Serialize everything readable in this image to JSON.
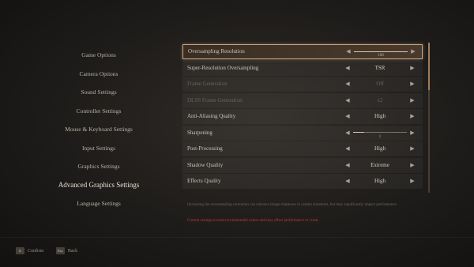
{
  "menu": {
    "items": [
      {
        "label": "Game Options",
        "active": false
      },
      {
        "label": "Camera Options",
        "active": false
      },
      {
        "label": "Sound Settings",
        "active": false
      },
      {
        "label": "Controller Settings",
        "active": false
      },
      {
        "label": "Mouse & Keyboard Settings",
        "active": false
      },
      {
        "label": "Input Settings",
        "active": false
      },
      {
        "label": "Graphics Settings",
        "active": false
      },
      {
        "label": "Advanced Graphics Settings",
        "active": true
      },
      {
        "label": "Language Settings",
        "active": false
      }
    ]
  },
  "settings": {
    "rows": [
      {
        "label": "Oversampling Resolution",
        "type": "slider",
        "value": "100",
        "fill": 1.0,
        "selected": true,
        "disabled": false
      },
      {
        "label": "Super-Resolution Oversampling",
        "type": "option",
        "value": "TSR",
        "selected": false,
        "disabled": false
      },
      {
        "label": "Frame Generation",
        "type": "option",
        "value": "Off",
        "selected": false,
        "disabled": true
      },
      {
        "label": "DLSS Frame Generation",
        "type": "option",
        "value": "x2",
        "selected": false,
        "disabled": true
      },
      {
        "label": "Anti-Aliasing Quality",
        "type": "option",
        "value": "High",
        "selected": false,
        "disabled": false
      },
      {
        "label": "Sharpening",
        "type": "slider",
        "value": "1",
        "fill": 0.2,
        "selected": false,
        "disabled": false
      },
      {
        "label": "Post-Processing",
        "type": "option",
        "value": "High",
        "selected": false,
        "disabled": false
      },
      {
        "label": "Shadow Quality",
        "type": "option",
        "value": "Extreme",
        "selected": false,
        "disabled": false
      },
      {
        "label": "Effects Quality",
        "type": "option",
        "value": "High",
        "selected": false,
        "disabled": false
      }
    ],
    "arrow_left": "◀",
    "arrow_right": "▶"
  },
  "description": {
    "text": "Increasing the oversampling resolution can enhance image sharpness in certain situations, but may significantly impact performance.",
    "warning": "Current settings exceed recommended values and may affect performance or crash."
  },
  "footer": {
    "confirm_key": "E",
    "confirm_label": "Confirm",
    "back_key": "Esc",
    "back_label": "Back"
  },
  "colors": {
    "accent": "#c9a77e",
    "warning": "#c03a2f"
  }
}
